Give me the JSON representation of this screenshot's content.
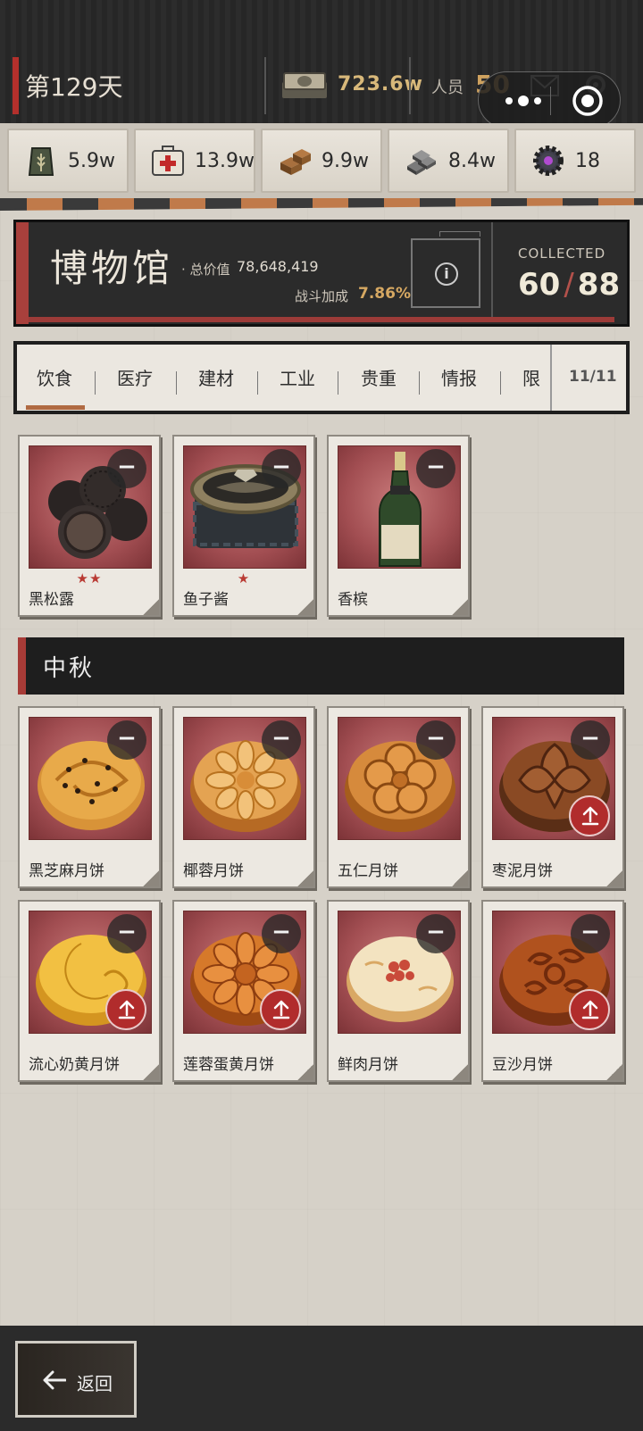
{
  "topbar": {
    "day": "第129天",
    "money": "723.6w",
    "staff_label": "人员",
    "staff_value": "50"
  },
  "resources": [
    {
      "icon": "grain-sack-icon",
      "value": "5.9w"
    },
    {
      "icon": "medkit-icon",
      "value": "13.9w"
    },
    {
      "icon": "wood-blocks-icon",
      "value": "9.9w"
    },
    {
      "icon": "steel-ingots-icon",
      "value": "8.4w"
    },
    {
      "icon": "gear-gem-icon",
      "value": "18"
    }
  ],
  "museum": {
    "title": "博物馆",
    "total_label": "· 总价值",
    "total_value": "78,648,419",
    "bonus_label": "战斗加成",
    "bonus_value": "7.86%",
    "collected_label": "COLLECTED",
    "collected_count": "60",
    "collected_total": "88"
  },
  "tabs": {
    "items": [
      "饮食",
      "医疗",
      "建材",
      "工业",
      "贵重",
      "情报",
      "限"
    ],
    "active_index": 0,
    "count": "11/11"
  },
  "food_items": [
    {
      "name": "黑松露",
      "stars": "★★"
    },
    {
      "name": "鱼子酱",
      "stars": "★"
    },
    {
      "name": "香槟",
      "stars": ""
    }
  ],
  "section": {
    "title": "中秋"
  },
  "mooncakes": [
    {
      "name": "黑芝麻月饼",
      "upgrade": false
    },
    {
      "name": "椰蓉月饼",
      "upgrade": false
    },
    {
      "name": "五仁月饼",
      "upgrade": false
    },
    {
      "name": "枣泥月饼",
      "upgrade": true
    },
    {
      "name": "流心奶黄月饼",
      "upgrade": true
    },
    {
      "name": "莲蓉蛋黄月饼",
      "upgrade": true
    },
    {
      "name": "鲜肉月饼",
      "upgrade": false
    },
    {
      "name": "豆沙月饼",
      "upgrade": true
    }
  ],
  "bottom": {
    "back_label": "返回"
  },
  "colors": {
    "accent_red": "#a73b37",
    "gold": "#d6a862",
    "dark_panel": "#2b2b2b"
  }
}
